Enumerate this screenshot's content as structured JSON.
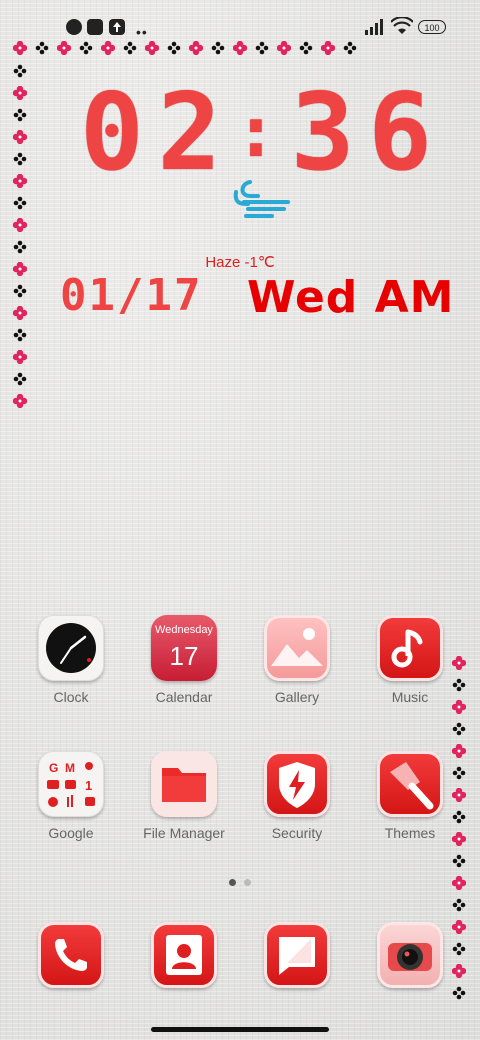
{
  "status_bar": {
    "battery": "100",
    "icons": [
      "app-notification-icon",
      "notification-square-icon",
      "upload-icon",
      "more-dots-icon",
      "signal-icon",
      "wifi-icon",
      "battery-icon"
    ]
  },
  "clock_widget": {
    "time_digits": [
      "0",
      "2",
      ":",
      "3",
      "6"
    ],
    "weather": "Haze  -1℃",
    "weather_icon": "wind-haze-icon",
    "date": "01/17",
    "day_ampm": "Wed AM"
  },
  "apps": [
    {
      "label": "Clock",
      "icon": "clock-icon"
    },
    {
      "label": "Calendar",
      "icon": "calendar-icon",
      "weekday": "Wednesday",
      "day": "17"
    },
    {
      "label": "Gallery",
      "icon": "gallery-icon"
    },
    {
      "label": "Music",
      "icon": "music-icon"
    },
    {
      "label": "Google",
      "icon": "google-folder-icon"
    },
    {
      "label": "File Manager",
      "icon": "folder-icon"
    },
    {
      "label": "Security",
      "icon": "security-shield-icon"
    },
    {
      "label": "Themes",
      "icon": "themes-brush-icon"
    }
  ],
  "dock": [
    {
      "name": "phone",
      "icon": "phone-icon"
    },
    {
      "name": "contacts",
      "icon": "contacts-icon"
    },
    {
      "name": "messages",
      "icon": "messages-icon"
    },
    {
      "name": "camera",
      "icon": "camera-icon"
    }
  ],
  "page_indicator": {
    "pages": 2,
    "current": 1
  },
  "colors": {
    "accent": "#ef4444",
    "flower_pink": "#e0245e",
    "flower_black": "#111111"
  }
}
